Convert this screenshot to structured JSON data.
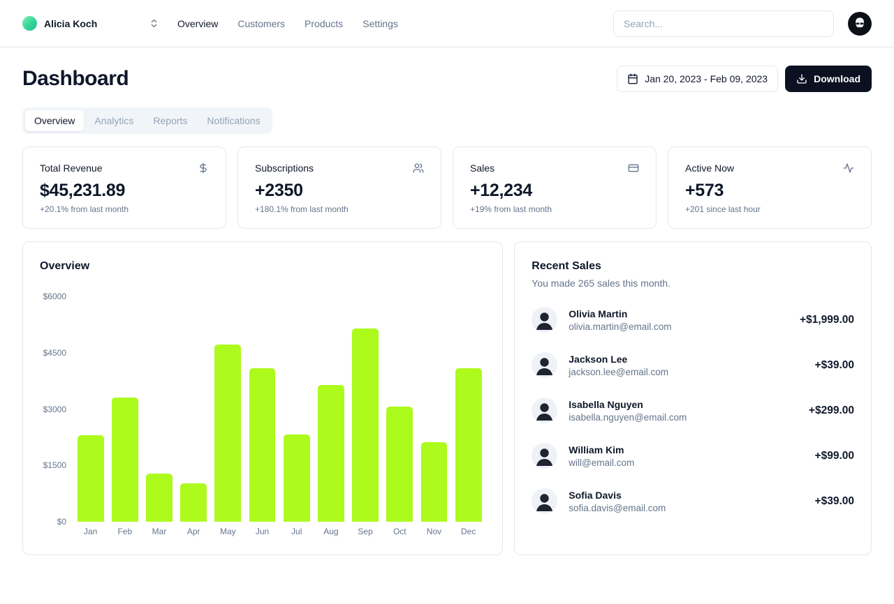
{
  "header": {
    "team": {
      "name": "Alicia Koch"
    },
    "nav": [
      {
        "label": "Overview",
        "active": true
      },
      {
        "label": "Customers",
        "active": false
      },
      {
        "label": "Products",
        "active": false
      },
      {
        "label": "Settings",
        "active": false
      }
    ],
    "search": {
      "placeholder": "Search..."
    }
  },
  "page": {
    "title": "Dashboard",
    "date_range": "Jan 20, 2023 - Feb 09, 2023",
    "download_label": "Download",
    "tabs": [
      {
        "label": "Overview",
        "active": true
      },
      {
        "label": "Analytics",
        "active": false
      },
      {
        "label": "Reports",
        "active": false
      },
      {
        "label": "Notifications",
        "active": false
      }
    ]
  },
  "stats": [
    {
      "title": "Total Revenue",
      "icon": "dollar-icon",
      "value": "$45,231.89",
      "change": "+20.1% from last month"
    },
    {
      "title": "Subscriptions",
      "icon": "users-icon",
      "value": "+2350",
      "change": "+180.1% from last month"
    },
    {
      "title": "Sales",
      "icon": "credit-card-icon",
      "value": "+12,234",
      "change": "+19% from last month"
    },
    {
      "title": "Active Now",
      "icon": "activity-icon",
      "value": "+573",
      "change": "+201 since last hour"
    }
  ],
  "chart_data": {
    "type": "bar",
    "title": "Overview",
    "categories": [
      "Jan",
      "Feb",
      "Mar",
      "Apr",
      "May",
      "Jun",
      "Jul",
      "Aug",
      "Sep",
      "Oct",
      "Nov",
      "Dec"
    ],
    "values": [
      2300,
      3300,
      1280,
      1020,
      4720,
      4090,
      2320,
      3640,
      5140,
      3060,
      2120,
      4090
    ],
    "xlabel": "",
    "ylabel": "",
    "ylim": [
      0,
      6000
    ],
    "ytick_labels": [
      "$0",
      "$1500",
      "$3000",
      "$4500",
      "$6000"
    ],
    "grid": false,
    "legend": false,
    "bar_color": "#adfa1d"
  },
  "recent_sales": {
    "title": "Recent Sales",
    "subtitle": "You made 265 sales this month.",
    "items": [
      {
        "name": "Olivia Martin",
        "email": "olivia.martin@email.com",
        "amount": "+$1,999.00"
      },
      {
        "name": "Jackson Lee",
        "email": "jackson.lee@email.com",
        "amount": "+$39.00"
      },
      {
        "name": "Isabella Nguyen",
        "email": "isabella.nguyen@email.com",
        "amount": "+$299.00"
      },
      {
        "name": "William Kim",
        "email": "will@email.com",
        "amount": "+$99.00"
      },
      {
        "name": "Sofia Davis",
        "email": "sofia.davis@email.com",
        "amount": "+$39.00"
      }
    ]
  },
  "colors": {
    "accent": "#adfa1d",
    "primary_text": "#0f172a",
    "muted_text": "#64748b",
    "border": "#e4e8ee",
    "button_dark": "#0b1120"
  }
}
